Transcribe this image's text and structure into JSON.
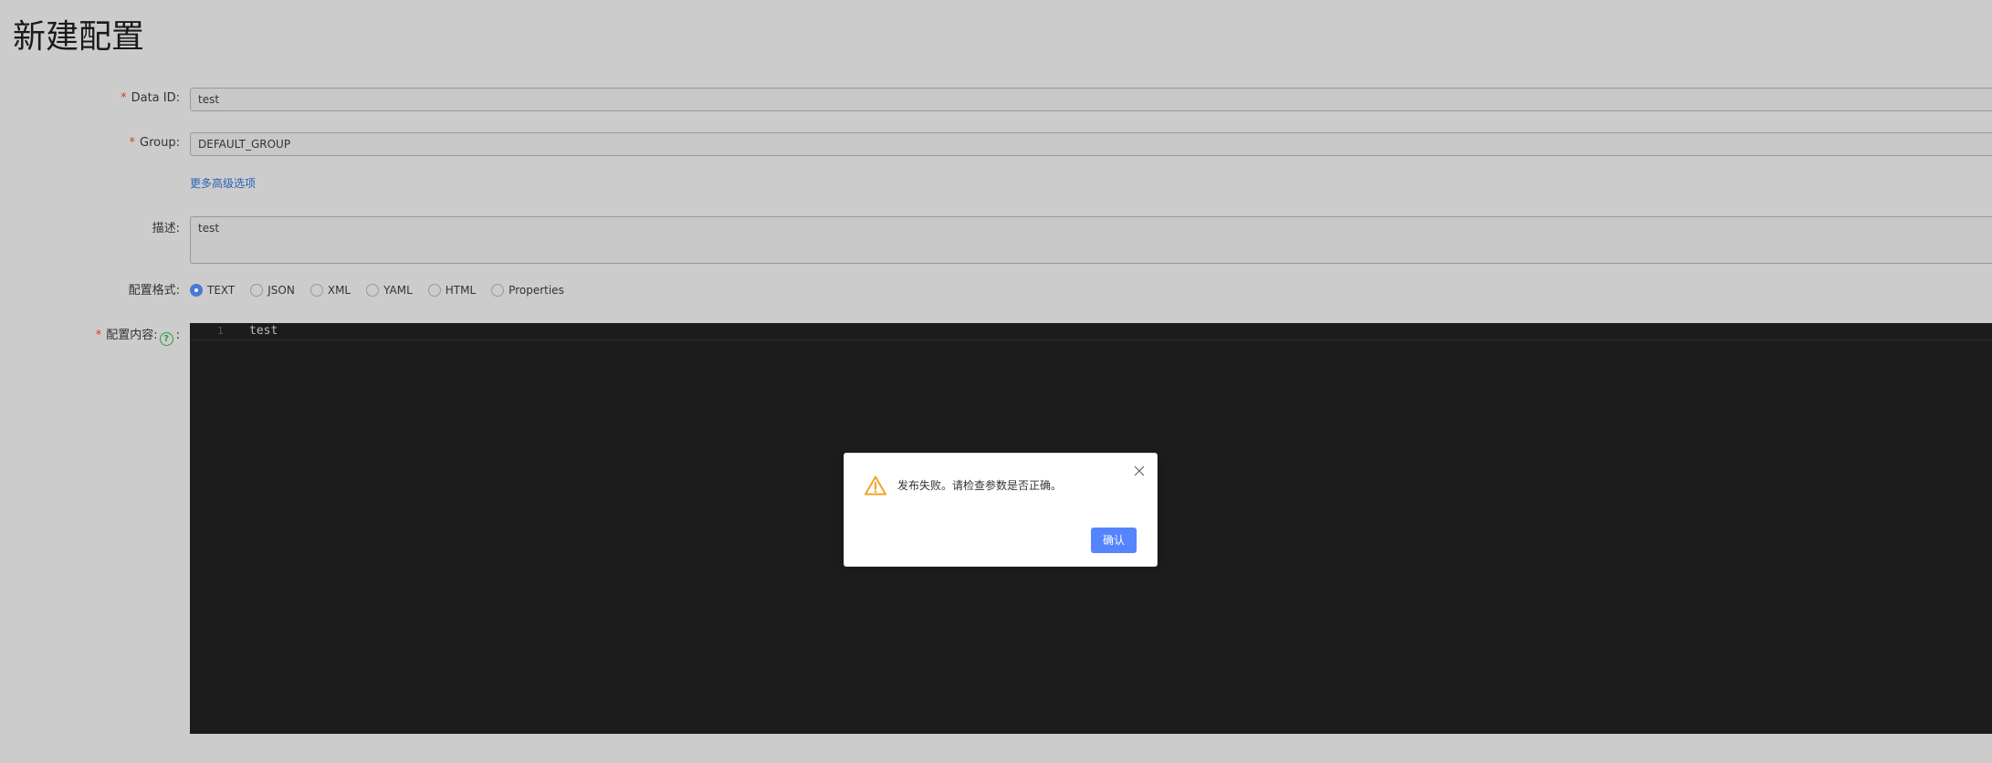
{
  "page": {
    "title": "新建配置"
  },
  "form": {
    "data_id": {
      "required_mark": "*",
      "label": "Data ID:",
      "value": "test"
    },
    "group": {
      "required_mark": "*",
      "label": "Group:",
      "value": "DEFAULT_GROUP"
    },
    "advanced_link": "更多高级选项",
    "description": {
      "label": "描述:",
      "value": "test"
    },
    "format": {
      "label": "配置格式:",
      "selected": "TEXT",
      "options": [
        {
          "label": "TEXT",
          "checked": true
        },
        {
          "label": "JSON",
          "checked": false
        },
        {
          "label": "XML",
          "checked": false
        },
        {
          "label": "YAML",
          "checked": false
        },
        {
          "label": "HTML",
          "checked": false
        },
        {
          "label": "Properties",
          "checked": false
        }
      ]
    },
    "content": {
      "required_mark": "*",
      "label": "配置内容:",
      "help_icon": "question-circle-icon",
      "colon": ":",
      "lines": [
        {
          "number": "1",
          "text": "test"
        }
      ]
    }
  },
  "dialog": {
    "icon": "warning-triangle-icon",
    "message": "发布失败。请检查参数是否正确。",
    "confirm_label": "确认",
    "close_icon": "close-icon"
  },
  "colors": {
    "background": "#cccccc",
    "editor_bg": "#1c1c1c",
    "primary_button": "#5584ff",
    "required_star": "#d23c26",
    "link": "#2c62b7",
    "warning": "#f1a325",
    "help_icon": "#2e9a3f"
  }
}
